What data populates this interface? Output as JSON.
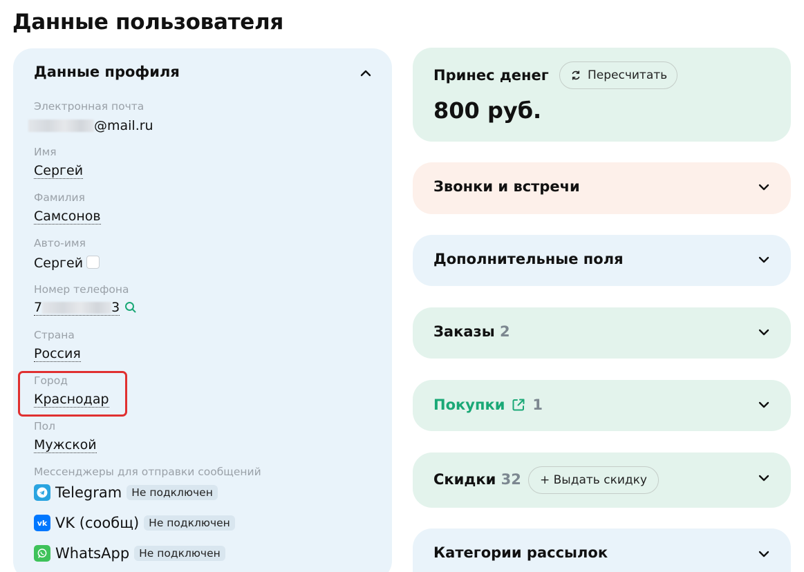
{
  "page": {
    "title": "Данные пользователя"
  },
  "profile": {
    "header": "Данные профиля",
    "fields": {
      "email": {
        "label": "Электронная почта",
        "suffix": "@mail.ru"
      },
      "first_name": {
        "label": "Имя",
        "value": "Сергей"
      },
      "last_name": {
        "label": "Фамилия",
        "value": "Самсонов"
      },
      "auto_name": {
        "label": "Авто-имя",
        "value": "Сергей"
      },
      "phone": {
        "label": "Номер телефона",
        "prefix": "7",
        "suffix": "3"
      },
      "country": {
        "label": "Страна",
        "value": "Россия"
      },
      "city": {
        "label": "Город",
        "value": "Краснодар"
      },
      "gender": {
        "label": "Пол",
        "value": "Мужской"
      }
    },
    "messengers": {
      "label": "Мессенджеры для отправки сообщений",
      "items": [
        {
          "name": "Telegram",
          "status": "Не подключен",
          "icon": "telegram-icon",
          "color": "#2aa4e0"
        },
        {
          "name": "VK (сообщ)",
          "status": "Не подключен",
          "icon": "vk-icon",
          "color": "#0077ff"
        },
        {
          "name": "WhatsApp",
          "status": "Не подключен",
          "icon": "whatsapp-icon",
          "color": "#3ec25a"
        }
      ]
    }
  },
  "cards": {
    "money": {
      "title": "Принес денег",
      "recalc_label": "Пересчитать",
      "amount": "800 руб."
    },
    "calls": {
      "title": "Звонки и встречи"
    },
    "extra_fields": {
      "title": "Дополнительные поля"
    },
    "orders": {
      "title": "Заказы",
      "count": "2"
    },
    "purchases": {
      "title": "Покупки",
      "count": "1"
    },
    "discounts": {
      "title": "Скидки",
      "count": "32",
      "button_label": "+ Выдать скидку"
    },
    "mailing": {
      "title": "Категории рассылок"
    }
  },
  "colors": {
    "profile_bg": "#e9f3fa",
    "money_bg": "#e3f3ec",
    "calls_bg": "#fdf0ea",
    "green_card_bg": "#e3f3ec",
    "highlight": "#e03030",
    "accent_green": "#1aa876"
  }
}
